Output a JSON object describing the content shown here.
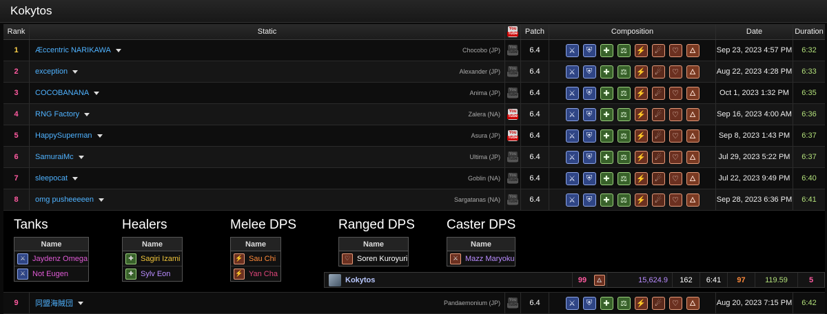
{
  "page_title": "Kokytos",
  "columns": {
    "rank": "Rank",
    "static": "Static",
    "patch": "Patch",
    "composition": "Composition",
    "date": "Date",
    "duration": "Duration"
  },
  "youtube_icon_text": {
    "top": "You",
    "bottom": "Tube"
  },
  "colors": {
    "rank_gold": "#ffd24a",
    "rank_pink": "#ff5aa0",
    "link": "#4fb2ff",
    "duration": "#b2e07a"
  },
  "rows": [
    {
      "rank": "1",
      "name": "Æccentric NARIKAWA",
      "server": "Chocobo (JP)",
      "youtube": false,
      "patch": "6.4",
      "date": "Sep 23, 2023 4:57 PM",
      "duration": "6:32"
    },
    {
      "rank": "2",
      "name": "exception",
      "server": "Alexander (JP)",
      "youtube": false,
      "patch": "6.4",
      "date": "Aug 22, 2023 4:28 PM",
      "duration": "6:33"
    },
    {
      "rank": "3",
      "name": "COCOBANANA",
      "server": "Anima (JP)",
      "youtube": false,
      "patch": "6.4",
      "date": "Oct 1, 2023 1:32 PM",
      "duration": "6:35"
    },
    {
      "rank": "4",
      "name": "RNG Factory",
      "server": "Zalera (NA)",
      "youtube": true,
      "patch": "6.4",
      "date": "Sep 16, 2023 4:00 AM",
      "duration": "6:36"
    },
    {
      "rank": "5",
      "name": "HappySuperman",
      "server": "Asura (JP)",
      "youtube": true,
      "patch": "6.4",
      "date": "Sep 8, 2023 1:43 PM",
      "duration": "6:37"
    },
    {
      "rank": "6",
      "name": "SamuraiMc",
      "server": "Ultima (JP)",
      "youtube": false,
      "patch": "6.4",
      "date": "Jul 29, 2023 5:22 PM",
      "duration": "6:37"
    },
    {
      "rank": "7",
      "name": "sleepocat",
      "server": "Goblin (NA)",
      "youtube": false,
      "patch": "6.4",
      "date": "Jul 22, 2023 9:49 PM",
      "duration": "6:40"
    },
    {
      "rank": "8",
      "name": "omg pusheeeeen",
      "server": "Sargatanas (NA)",
      "youtube": false,
      "patch": "6.4",
      "date": "Sep 28, 2023 6:36 PM",
      "duration": "6:41"
    },
    {
      "rank": "9",
      "name": "同盟海賊団",
      "server": "Pandaemonium (JP)",
      "youtube": false,
      "patch": "6.4",
      "date": "Aug 20, 2023 7:15 PM",
      "duration": "6:42"
    }
  ],
  "expanded": {
    "groups": [
      {
        "title": "Tanks",
        "header": "Name",
        "members": [
          {
            "name": "Jaydenz Omega",
            "color": "#e05ad6"
          },
          {
            "name": "Not Eugen",
            "color": "#e05ad6"
          }
        ]
      },
      {
        "title": "Healers",
        "header": "Name",
        "members": [
          {
            "name": "Sagiri Izami",
            "color": "#f0c53a"
          },
          {
            "name": "Sylv Eon",
            "color": "#b98cff"
          }
        ]
      },
      {
        "title": "Melee DPS",
        "header": "Name",
        "members": [
          {
            "name": "Sau Chi",
            "color": "#ff8a3a"
          },
          {
            "name": "Yan Cha",
            "color": "#e0457a"
          }
        ]
      },
      {
        "title": "Ranged DPS",
        "header": "Name",
        "members": [
          {
            "name": "Soren Kuroyuri",
            "color": "#ffffff"
          }
        ]
      },
      {
        "title": "Caster DPS",
        "header": "Name",
        "members": [
          {
            "name": "Mazz Maryoku",
            "color": "#b98cff"
          }
        ]
      }
    ],
    "subrow": {
      "name": "Kokytos",
      "val1": "99",
      "val2": "15,624.9",
      "val3": "162",
      "val4": "6:41",
      "val5": "97",
      "val6": "119.59",
      "val7": "5"
    }
  }
}
